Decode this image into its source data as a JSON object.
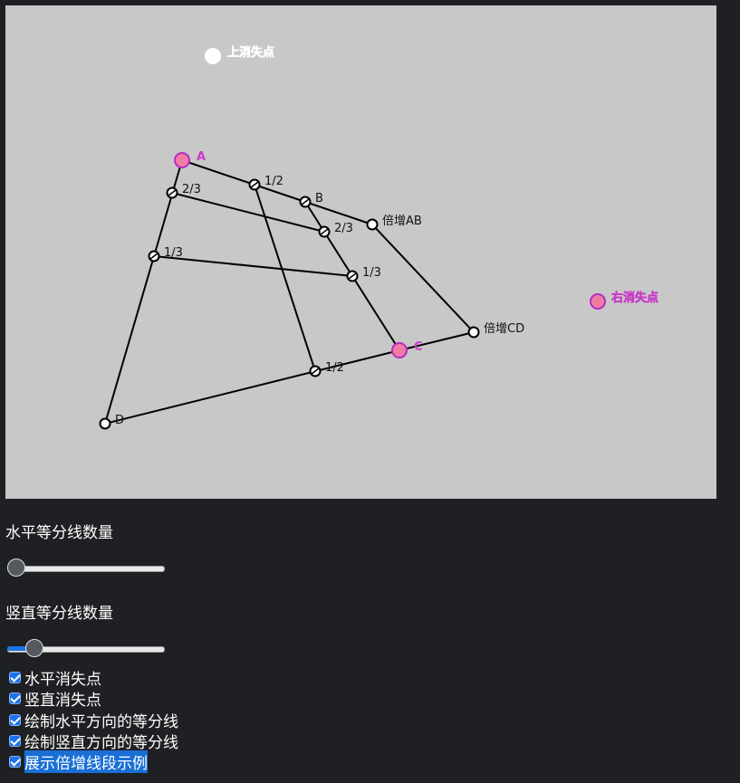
{
  "canvas": {
    "points": {
      "vanish_top": "上消失点",
      "vanish_right": "右消失点",
      "A": "A",
      "B": "B",
      "C": "C",
      "D": "D",
      "double_ab": "倍增AB",
      "double_cd": "倍增CD"
    },
    "fraction_labels": {
      "ab_half": "1/2",
      "dc_half": "1/2",
      "ad_two_thirds": "2/3",
      "ad_one_third": "1/3",
      "bc_two_thirds": "2/3",
      "bc_one_third": "1/3"
    },
    "colors": {
      "background": "#c8c8c8",
      "handle_fill": "#f07ca6",
      "handle_stroke": "#b42ec0",
      "label_magenta": "#c83cc8",
      "line": "#000000"
    }
  },
  "controls": {
    "horizontal_count_label": "水平等分线数量",
    "horizontal_count_value": 0,
    "vertical_count_label": "竖直等分线数量",
    "vertical_count_value": 0.13,
    "checkboxes": [
      {
        "label": "水平消失点",
        "checked": true
      },
      {
        "label": "竖直消失点",
        "checked": true
      },
      {
        "label": "绘制水平方向的等分线",
        "checked": true
      },
      {
        "label": "绘制竖直方向的等分线",
        "checked": true
      },
      {
        "label": "展示倍增线段示例",
        "checked": true,
        "selected": true
      }
    ]
  }
}
